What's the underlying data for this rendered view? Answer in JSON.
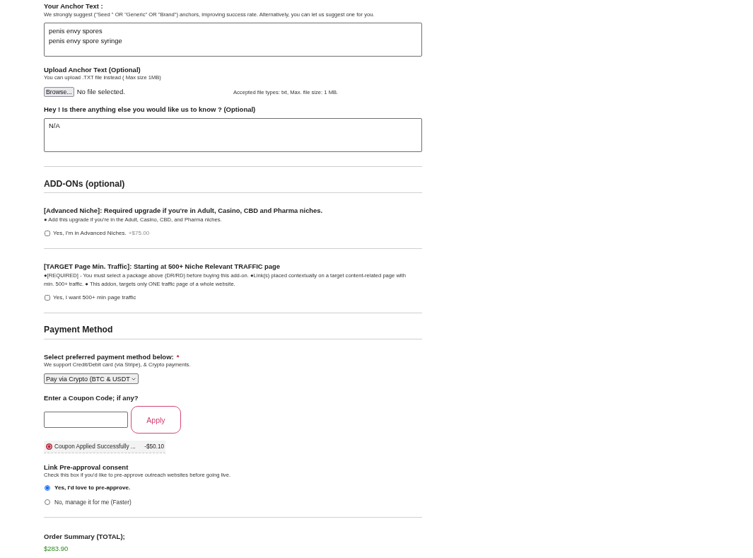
{
  "anchor_text": {
    "label": "Your Anchor Text :",
    "hint": "We strongly suggest (\"Seed \" OR \"Generic\" OR \"Brand\") anchors, improving success rate. Alternatively, you can let us suggest one for you.",
    "value": "penis envy spores\npenis envy spore syringe"
  },
  "upload": {
    "label": "Upload Anchor Text (Optional)",
    "hint": "You can upload .TXT file instead ( Max size 1MB)",
    "browse_button": "Browse...",
    "file_status": "No file selected.",
    "accepted_note": "Accepted file types: txt, Max. file size: 1 MB."
  },
  "notes": {
    "label": "Hey ! Is there anything else you would like us to know ? (Optional)",
    "value": "N/A"
  },
  "addons": {
    "heading": "ADD-ONs (optional)",
    "items": [
      {
        "title": "[Advanced Niche]: Required upgrade if you're in Adult, Casino, CBD and Pharma niches.",
        "description": "● Add this upgrade if you're in the Adult, Casino, CBD, and Pharma niches.",
        "checkbox_label": "Yes, I'm in Advanced Niches.",
        "price": "+$75.00",
        "checked": false
      },
      {
        "title": "[TARGET Page Min. Traffic]: Starting at 500+ Niche Relevant TRAFFIC page",
        "description": "●[REQUIRED] - You must select a package above (DR/RD) before buying this add-on. ●Link(s) placed contextually on a target content-related page with min. 500+ traffic. ● This addon, targets only ONE traffic page of a whole website.",
        "checkbox_label": "Yes, I want 500+ min page traffic",
        "checked": false
      }
    ]
  },
  "payment": {
    "heading": "Payment Method",
    "method_label": "Select preferred payment method below:",
    "required_mark": "*",
    "method_hint": "We support Credit/Debit card (via Stripe), & Crypto payments.",
    "method_select": "Pay via Crypto (BTC & USDT",
    "coupon_label": "Enter a Coupon Code; if any?",
    "apply_button": "Apply",
    "coupon_status": {
      "text": "Coupon Applied Successfully ...",
      "amount": "-$50.10"
    }
  },
  "preapproval": {
    "heading": "Link Pre-approval consent",
    "hint": "Check this box if you'd like to pre-approve outreach websites before going live.",
    "options": [
      {
        "label": "Yes, I'd love to pre-approve.",
        "selected": true
      },
      {
        "label": "No, manage it for me (Faster)",
        "selected": false
      }
    ]
  },
  "order_summary": {
    "label": "Order Summary (TOTAL);",
    "total": "$283.90"
  }
}
